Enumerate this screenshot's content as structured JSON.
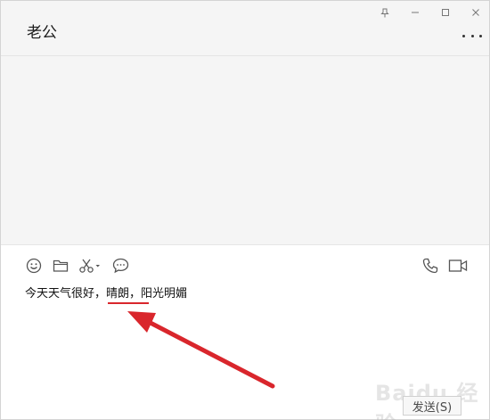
{
  "window": {
    "controls": [
      "pin-icon",
      "minimize-icon",
      "maximize-icon",
      "close-icon"
    ]
  },
  "chat": {
    "title": "老公",
    "more_icon": "more-dots-icon"
  },
  "toolbar": {
    "left_icons": [
      "emoji-icon",
      "folder-icon",
      "scissors-icon",
      "chat-bubble-icon"
    ],
    "right_icons": [
      "phone-icon",
      "video-icon"
    ]
  },
  "input": {
    "value": "今天天气很好，晴朗，阳光明媚"
  },
  "send_button": {
    "label": "发送(S)"
  },
  "annotation": {
    "color": "#d9262c"
  },
  "watermark": {
    "text": "Baidu 经验"
  }
}
